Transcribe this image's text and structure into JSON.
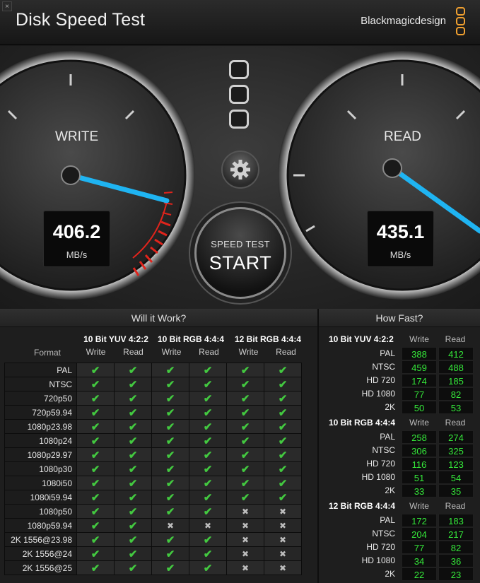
{
  "window": {
    "close_glyph": "×",
    "title": "Disk Speed Test",
    "brand": "Blackmagicdesign"
  },
  "gauges": {
    "write": {
      "label": "WRITE",
      "value": "406.2",
      "unit": "MB/s"
    },
    "read": {
      "label": "READ",
      "value": "435.1",
      "unit": "MB/s"
    }
  },
  "start_button": {
    "sub": "SPEED TEST",
    "main": "START"
  },
  "icons": {
    "settings": "gear-icon",
    "logo": "blackmagic-logo-icon"
  },
  "colors": {
    "accent": "#f0a030",
    "needle": "#1fb4f2",
    "redzone": "#e0241c",
    "ok": "#43c940",
    "speed": "#35e83a"
  },
  "will_it_work": {
    "title": "Will it Work?",
    "format_header": "Format",
    "groups": [
      "10 Bit YUV 4:2:2",
      "10 Bit RGB 4:4:4",
      "12 Bit RGB 4:4:4"
    ],
    "sub_headers": [
      "Write",
      "Read",
      "Write",
      "Read",
      "Write",
      "Read"
    ],
    "rows": [
      {
        "format": "PAL",
        "cells": [
          1,
          1,
          1,
          1,
          1,
          1
        ]
      },
      {
        "format": "NTSC",
        "cells": [
          1,
          1,
          1,
          1,
          1,
          1
        ]
      },
      {
        "format": "720p50",
        "cells": [
          1,
          1,
          1,
          1,
          1,
          1
        ]
      },
      {
        "format": "720p59.94",
        "cells": [
          1,
          1,
          1,
          1,
          1,
          1
        ]
      },
      {
        "format": "1080p23.98",
        "cells": [
          1,
          1,
          1,
          1,
          1,
          1
        ]
      },
      {
        "format": "1080p24",
        "cells": [
          1,
          1,
          1,
          1,
          1,
          1
        ]
      },
      {
        "format": "1080p29.97",
        "cells": [
          1,
          1,
          1,
          1,
          1,
          1
        ]
      },
      {
        "format": "1080p30",
        "cells": [
          1,
          1,
          1,
          1,
          1,
          1
        ]
      },
      {
        "format": "1080i50",
        "cells": [
          1,
          1,
          1,
          1,
          1,
          1
        ]
      },
      {
        "format": "1080i59.94",
        "cells": [
          1,
          1,
          1,
          1,
          1,
          1
        ]
      },
      {
        "format": "1080p50",
        "cells": [
          1,
          1,
          1,
          1,
          0,
          0
        ]
      },
      {
        "format": "1080p59.94",
        "cells": [
          1,
          1,
          0,
          0,
          0,
          0
        ]
      },
      {
        "format": "2K 1556@23.98",
        "cells": [
          1,
          1,
          1,
          1,
          0,
          0
        ]
      },
      {
        "format": "2K 1556@24",
        "cells": [
          1,
          1,
          1,
          1,
          0,
          0
        ]
      },
      {
        "format": "2K 1556@25",
        "cells": [
          1,
          1,
          1,
          1,
          0,
          0
        ]
      }
    ]
  },
  "how_fast": {
    "title": "How Fast?",
    "write_label": "Write",
    "read_label": "Read",
    "groups": [
      {
        "name": "10 Bit YUV 4:2:2",
        "rows": [
          {
            "label": "PAL",
            "write": "388",
            "read": "412"
          },
          {
            "label": "NTSC",
            "write": "459",
            "read": "488"
          },
          {
            "label": "HD 720",
            "write": "174",
            "read": "185"
          },
          {
            "label": "HD 1080",
            "write": "77",
            "read": "82"
          },
          {
            "label": "2K",
            "write": "50",
            "read": "53"
          }
        ]
      },
      {
        "name": "10 Bit RGB 4:4:4",
        "rows": [
          {
            "label": "PAL",
            "write": "258",
            "read": "274"
          },
          {
            "label": "NTSC",
            "write": "306",
            "read": "325"
          },
          {
            "label": "HD 720",
            "write": "116",
            "read": "123"
          },
          {
            "label": "HD 1080",
            "write": "51",
            "read": "54"
          },
          {
            "label": "2K",
            "write": "33",
            "read": "35"
          }
        ]
      },
      {
        "name": "12 Bit RGB 4:4:4",
        "rows": [
          {
            "label": "PAL",
            "write": "172",
            "read": "183"
          },
          {
            "label": "NTSC",
            "write": "204",
            "read": "217"
          },
          {
            "label": "HD 720",
            "write": "77",
            "read": "82"
          },
          {
            "label": "HD 1080",
            "write": "34",
            "read": "36"
          },
          {
            "label": "2K",
            "write": "22",
            "read": "23"
          }
        ]
      }
    ]
  }
}
